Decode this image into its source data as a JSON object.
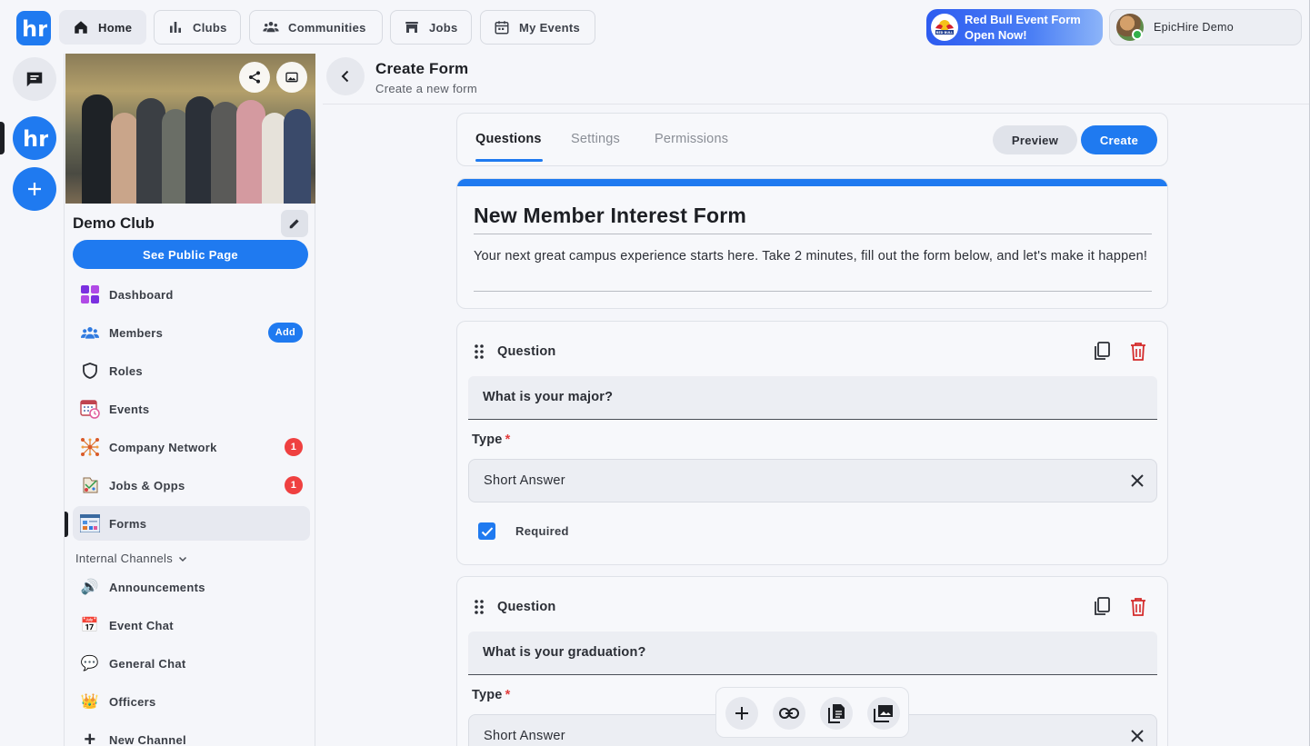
{
  "topnav": {
    "items": [
      {
        "label": "Home",
        "icon": "home-icon",
        "active": true
      },
      {
        "label": "Clubs",
        "icon": "bar-chart-icon"
      },
      {
        "label": "Communities",
        "icon": "people-icon"
      },
      {
        "label": "Jobs",
        "icon": "store-icon"
      },
      {
        "label": "My Events",
        "icon": "calendar-icon"
      }
    ],
    "promo": {
      "line1": "Red Bull Event Form",
      "line2": "Open Now!",
      "logo_text": "RED BULL"
    },
    "user": {
      "name": "EpicHire Demo",
      "status_color": "#33b04a"
    }
  },
  "logo_text": "hr",
  "club": {
    "name": "Demo Club",
    "public_page_label": "See Public Page"
  },
  "sidebar": {
    "items": [
      {
        "label": "Dashboard",
        "icon": "dashboard-icon"
      },
      {
        "label": "Members",
        "icon": "members-icon",
        "action": "Add"
      },
      {
        "label": "Roles",
        "icon": "shield-icon"
      },
      {
        "label": "Events",
        "icon": "calendar-clock-icon"
      },
      {
        "label": "Company Network",
        "icon": "network-icon",
        "badge": "1"
      },
      {
        "label": "Jobs & Opps",
        "icon": "jobs-icon",
        "badge": "1"
      },
      {
        "label": "Forms",
        "icon": "forms-icon",
        "active": true
      }
    ],
    "section": "Internal Channels",
    "channels": [
      {
        "label": "Announcements",
        "icon": "speaker-icon",
        "glyph": "🔊"
      },
      {
        "label": "Event Chat",
        "icon": "calendar-emoji-icon",
        "glyph": "📅"
      },
      {
        "label": "General Chat",
        "icon": "speech-bubble-icon",
        "glyph": "💬"
      },
      {
        "label": "Officers",
        "icon": "crown-icon",
        "glyph": "👑"
      },
      {
        "label": "New Channel",
        "icon": "plus-icon",
        "glyph": "+"
      }
    ]
  },
  "header": {
    "title": "Create Form",
    "subtitle": "Create a new form"
  },
  "tabs": {
    "items": [
      "Questions",
      "Settings",
      "Permissions"
    ],
    "active": "Questions",
    "preview_label": "Preview",
    "create_label": "Create"
  },
  "form": {
    "title": "New Member Interest Form",
    "description": "Your next great campus experience starts here. Take 2 minutes, fill out the form below, and let's make it happen!",
    "accent_color": "#1f7af0"
  },
  "questions": [
    {
      "label": "Question",
      "text": "What is your major?",
      "type_label": "Type",
      "required_mark": "*",
      "type_value": "Short Answer",
      "required_label": "Required",
      "required": true
    },
    {
      "label": "Question",
      "text": "What is your graduation?",
      "type_label": "Type",
      "required_mark": "*",
      "type_value": "Short Answer"
    }
  ],
  "toolbar": {
    "buttons": [
      "add-question-icon",
      "link-icon",
      "copy-file-icon",
      "image-gallery-icon"
    ]
  }
}
